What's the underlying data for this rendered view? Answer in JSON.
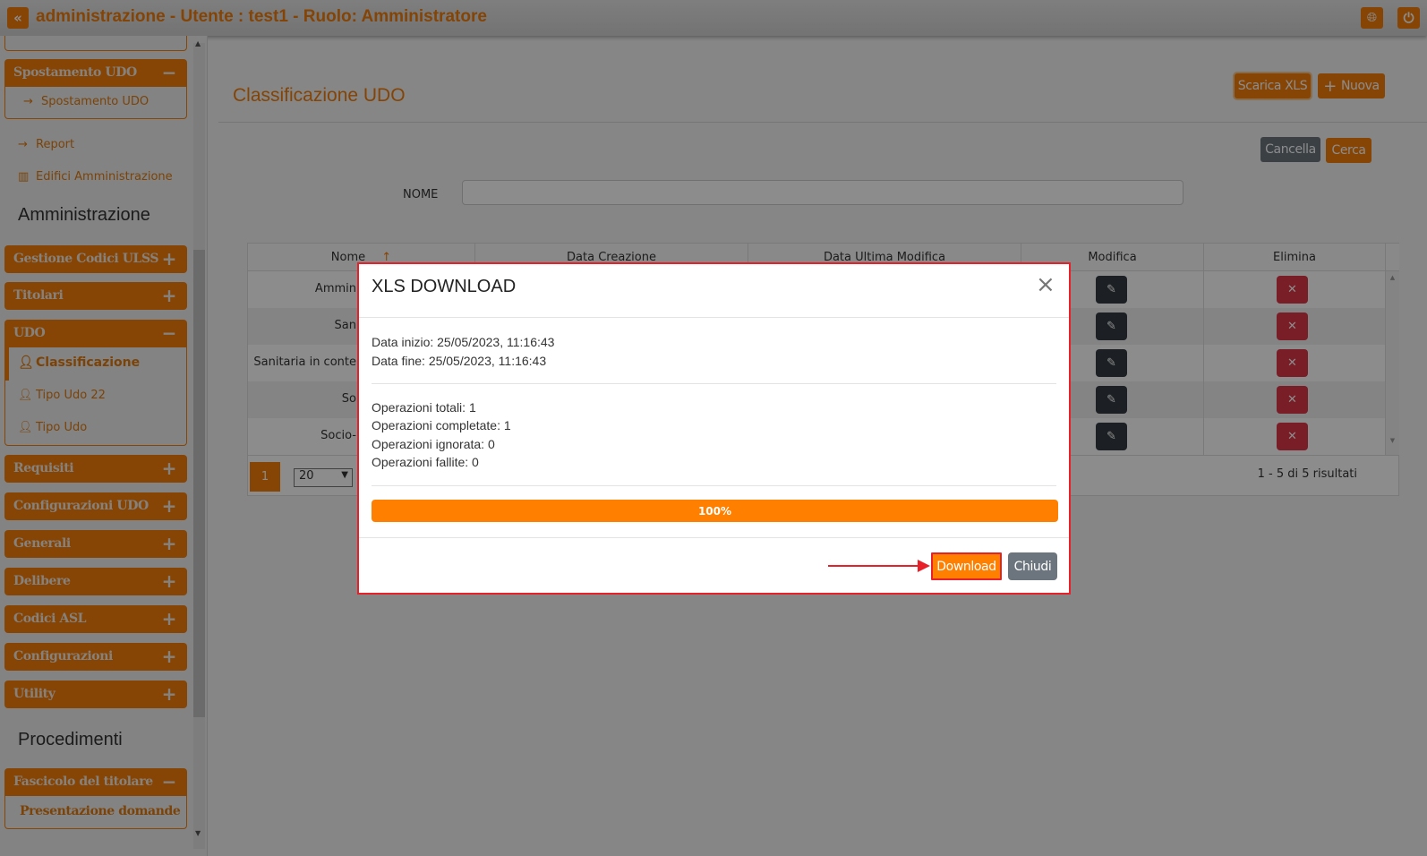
{
  "header": {
    "title": "administrazione - Utente : test1 - Ruolo: Amministratore",
    "collapse_icon": "double-chevron-left-icon",
    "globe_icon": "globe-icon",
    "power_icon": "power-icon"
  },
  "sidebar": {
    "spostamento": {
      "label": "Spostamento UDO",
      "sign": "−",
      "items": [
        {
          "label": "Spostamento UDO"
        }
      ]
    },
    "links": [
      {
        "label": "Report",
        "icon": "arrow-right-icon"
      },
      {
        "label": "Edifici Amministrazione",
        "icon": "building-icon"
      }
    ],
    "section_admin": "Amministrazione",
    "groups": [
      {
        "label": "Gestione Codici ULSS",
        "sign": "+"
      },
      {
        "label": "Titolari",
        "sign": "+"
      },
      {
        "label": "UDO",
        "sign": "−"
      },
      {
        "label": "Requisiti",
        "sign": "+"
      },
      {
        "label": "Configurazioni UDO",
        "sign": "+"
      },
      {
        "label": "Generali",
        "sign": "+"
      },
      {
        "label": "Delibere",
        "sign": "+"
      },
      {
        "label": "Codici ASL",
        "sign": "+"
      },
      {
        "label": "Configurazioni",
        "sign": "+"
      },
      {
        "label": "Utility",
        "sign": "+"
      }
    ],
    "udo_items": [
      {
        "label": "Classificazione",
        "active": true
      },
      {
        "label": "Tipo Udo 22"
      },
      {
        "label": "Tipo Udo"
      }
    ],
    "section_proc": "Procedimenti",
    "fascicolo": {
      "label": "Fascicolo del titolare",
      "sign": "−",
      "items": [
        {
          "label": "Presentazione domande"
        }
      ]
    }
  },
  "main": {
    "title": "Classificazione UDO",
    "scarica_label": "Scarica XLS",
    "nuova_label": "Nuova",
    "cancella_label": "Cancella",
    "cerca_label": "Cerca",
    "nome_label": "NOME",
    "nome_value": "",
    "table": {
      "columns": [
        "Nome",
        "Data Creazione",
        "Data Ultima Modifica",
        "Modifica",
        "Elimina"
      ],
      "rows": [
        "Ammin",
        "San",
        "Sanitaria in conte",
        "So",
        "Socio-"
      ],
      "page": "1",
      "page_size": "20",
      "summary": "1 - 5 di 5 risultati"
    }
  },
  "modal": {
    "title": "XLS DOWNLOAD",
    "data_inizio": "Data inizio: 25/05/2023, 11:16:43",
    "data_fine": "Data fine: 25/05/2023, 11:16:43",
    "op_totali": "Operazioni totali: 1",
    "op_completate": "Operazioni completate: 1",
    "op_ignorata": "Operazioni ignorata: 0",
    "op_fallite": "Operazioni fallite: 0",
    "progress_percent": 100,
    "progress_label": "100%",
    "download_label": "Download",
    "chiudi_label": "Chiudi"
  },
  "colors": {
    "accent": "#f47f0a",
    "progress": "#ff8000",
    "danger": "#dc3545",
    "dark": "#343a40",
    "secondary": "#6c757d",
    "annotation": "#e8202a"
  }
}
